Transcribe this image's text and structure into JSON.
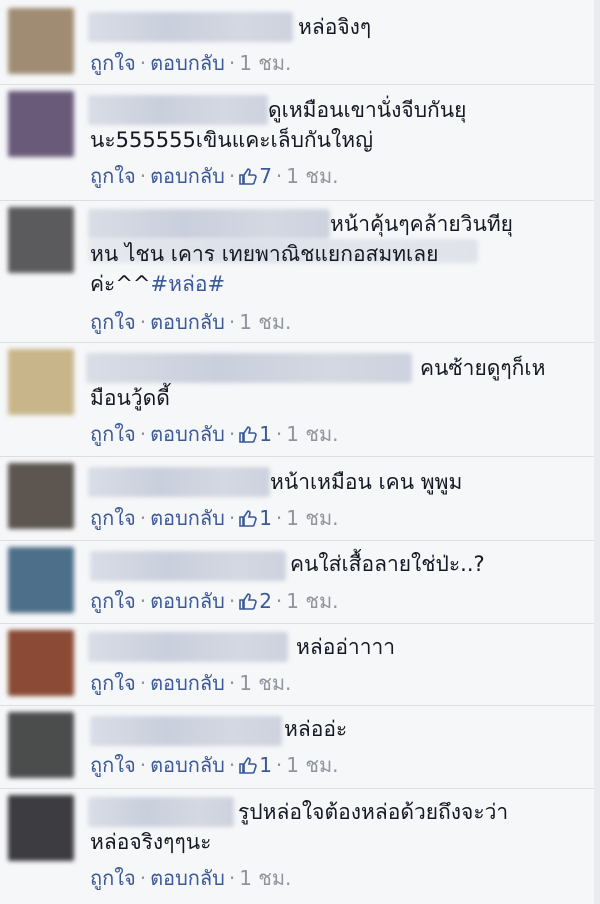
{
  "actions": {
    "like_label": "ถูกใจ",
    "reply_label": "ตอบกลับ",
    "separator": "·"
  },
  "comments": [
    {
      "text": "หล่อจิงๆ",
      "likes": "",
      "time": "1 ชม.",
      "avatar_color": "#a08c73"
    },
    {
      "text_line1": "ดูเหมือนเขานั่งจีบกันยุ",
      "text_line2": "นะ555555เขินแคะเล็บกันใหญ่",
      "likes": "7",
      "time": "1 ชม.",
      "avatar_color": "#6a5a7a"
    },
    {
      "text_line1": "หน้าคุ้นๆคล้ายวินทียุ",
      "text_line2": "หน ไชน เคาร เทยพาณิชแยกอสมทเลย",
      "text_line3_prefix": "ค่ะ^^",
      "hashtag": "#หล่อ#",
      "likes": "",
      "time": "1 ชม.",
      "avatar_color": "#5b5a5c"
    },
    {
      "text_line1": "คนซ้ายดูๆก็เห",
      "text_line2": "มือนวู้ดดี้",
      "likes": "1",
      "time": "1 ชม.",
      "avatar_color": "#c8b58a"
    },
    {
      "text": "หน้าเหมือน เคน พูพูม",
      "likes": "1",
      "time": "1 ชม.",
      "avatar_color": "#5c5550"
    },
    {
      "text": "คนใส่เสื้อลายใช่ป่ะ..?",
      "likes": "2",
      "time": "1 ชม.",
      "avatar_color": "#4e6f8a"
    },
    {
      "text": "หล่ออ่าาาา",
      "likes": "",
      "time": "1 ชม.",
      "avatar_color": "#8a4a35"
    },
    {
      "text": "หล่ออ่ะ",
      "likes": "1",
      "time": "1 ชม.",
      "avatar_color": "#4a4d4c"
    },
    {
      "text_line1": "รูปหล่อใจต้องหล่อด้วยถึงจะว่า",
      "text_line2": "หล่อจริงๆๆนะ",
      "likes": "",
      "time": "1 ชม.",
      "avatar_color": "#3d3c40"
    }
  ]
}
